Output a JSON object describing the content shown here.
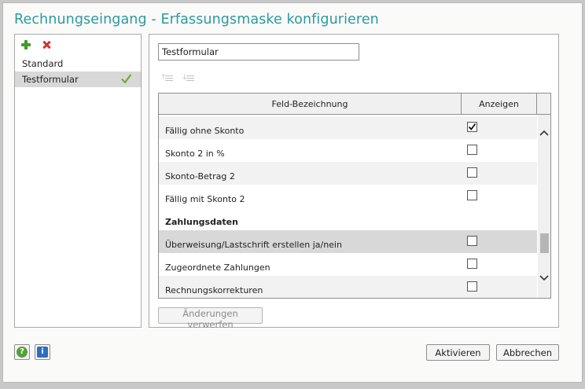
{
  "dialog": {
    "title": "Rechnungseingang - Erfassungsmaske konfigurieren"
  },
  "forms": {
    "add_icon": "plus-icon",
    "delete_icon": "delete-icon",
    "items": [
      {
        "label": "Standard",
        "selected": false
      },
      {
        "label": "Testformular",
        "selected": true,
        "active_icon": "check-icon"
      }
    ]
  },
  "editor": {
    "name_value": "Testformular",
    "move_up_icon": "move-up-icon",
    "move_down_icon": "move-down-icon",
    "grid": {
      "headers": {
        "field": "Feld-Bezeichnung",
        "show": "Anzeigen"
      },
      "rows": [
        {
          "label": "Fällig ohne Skonto",
          "type": "field",
          "checked": true
        },
        {
          "label": "Skonto 2 in %",
          "type": "field",
          "checked": false
        },
        {
          "label": "Skonto-Betrag 2",
          "type": "field",
          "checked": false
        },
        {
          "label": "Fällig mit Skonto 2",
          "type": "field",
          "checked": false
        },
        {
          "label": "Zahlungsdaten",
          "type": "group"
        },
        {
          "label": "Überweisung/Lastschrift erstellen ja/nein",
          "type": "field",
          "checked": false
        },
        {
          "label": "Zugeordnete Zahlungen",
          "type": "field",
          "checked": false
        },
        {
          "label": "Rechnungskorrekturen",
          "type": "field",
          "checked": false
        }
      ]
    },
    "discard_label": "Änderungen verwerfen"
  },
  "footer": {
    "help_glyph": "?",
    "info_glyph": "i",
    "activate_label": "Aktivieren",
    "cancel_label": "Abbrechen"
  },
  "colors": {
    "title": "#2b9aa0",
    "add": "#3f9a2a",
    "delete": "#d23232",
    "check": "#6aaa2a"
  }
}
